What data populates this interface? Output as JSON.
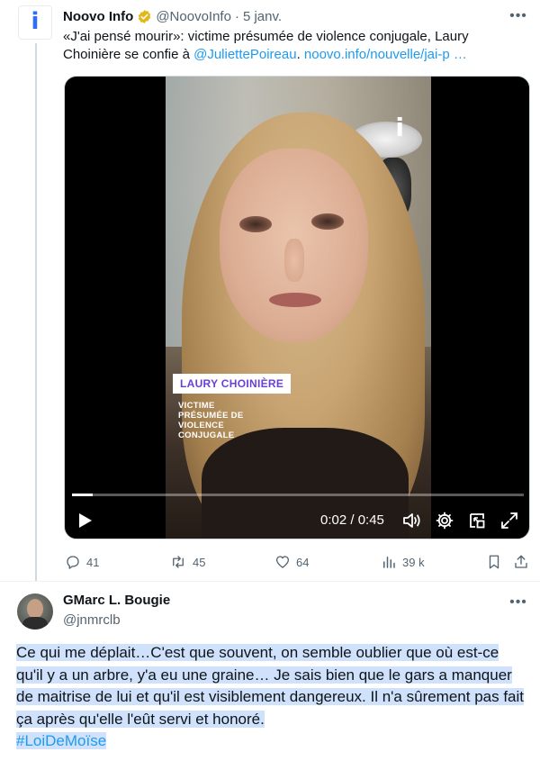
{
  "tweet1": {
    "display_name": "Noovo Info",
    "handle": "@NoovoInfo",
    "separator": "·",
    "date": "5 janv.",
    "text_main": "«J'ai pensé mourir»: victime présumée de violence conjugale, Laury Choinière se confie à ",
    "mention": "@JuliettePoireau",
    "text_after_mention": ". ",
    "link": "noovo.info/nouvelle/jai-p …",
    "avatar_icon": "noovo-logo-icon",
    "video": {
      "overlay_name": "LAURY CHOINIÈRE",
      "overlay_description": "VICTIME PRÉSUMÉE DE VIOLENCE CONJUGALE",
      "brand_overlay": "i",
      "time_display": "0:02 / 0:45",
      "progress_fraction": 0.045
    },
    "actions": {
      "replies": "41",
      "reposts": "45",
      "likes": "64",
      "views": "39 k"
    }
  },
  "tweet2": {
    "display_name": "GMarc L. Bougie",
    "handle": "@jnmrclb",
    "body": "Ce qui me déplait…C'est que souvent, on semble oublier que où est-ce qu'il y a un arbre, y'a eu une graine…  Je sais bien que le gars a manquer de maitrise de lui et qu'il est visiblement dangereux. Il n'a sûrement pas fait ça après qu'elle l'eût servi et honoré.",
    "hashtag": "#LoiDeMoïse"
  },
  "colors": {
    "link": "#1d9bf0",
    "muted": "#536471",
    "selection": "#cfe1fb",
    "overlay_purple": "#6a3fd8",
    "noovo_blue": "#2f6bff"
  }
}
